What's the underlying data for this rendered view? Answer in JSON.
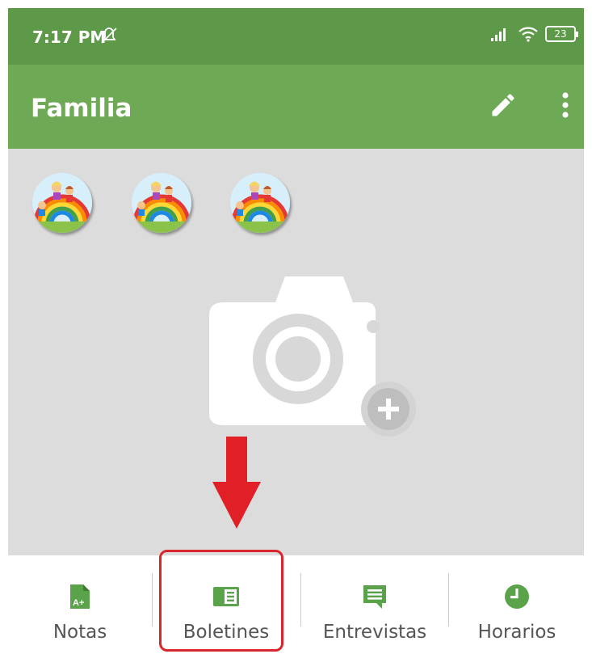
{
  "status_bar": {
    "time": "7:17 PM",
    "battery": "23",
    "icons": [
      "do-not-disturb-icon",
      "signal-icon",
      "wifi-icon",
      "battery-icon"
    ]
  },
  "app_bar": {
    "title": "Familia",
    "actions": [
      "edit-icon",
      "more-vert-icon"
    ]
  },
  "avatars": [
    {
      "name": "child-avatar-1"
    },
    {
      "name": "child-avatar-2"
    },
    {
      "name": "child-avatar-3"
    }
  ],
  "photo_placeholder": {
    "icon": "add-photo-icon"
  },
  "bottom_nav": {
    "items": [
      {
        "label": "Notas",
        "icon": "grade-icon"
      },
      {
        "label": "Boletines",
        "icon": "report-icon"
      },
      {
        "label": "Entrevistas",
        "icon": "chat-icon"
      },
      {
        "label": "Horarios",
        "icon": "clock-icon"
      }
    ]
  },
  "colors": {
    "status_bar": "#5e9849",
    "app_bar": "#6ea955",
    "accent": "#5aa34a",
    "highlight": "#d8262c",
    "content_bg": "#dcdcdc"
  }
}
